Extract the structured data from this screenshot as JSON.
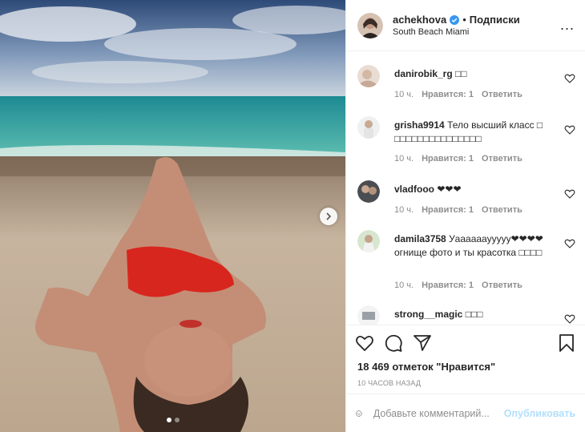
{
  "header": {
    "username": "achekhova",
    "separator": "•",
    "follow_label": "Подписки",
    "location": "South Beach Miami",
    "more_label": "..."
  },
  "comments": [
    {
      "user": "danirobik_rg",
      "text": "□□",
      "time": "10 ч.",
      "likes": "Нравится: 1",
      "reply": "Ответить"
    },
    {
      "user": "grisha9914",
      "text": "Тело высший класс □ □□□□□□□□□□□□□□□",
      "time": "10 ч.",
      "likes": "Нравится: 1",
      "reply": "Ответить"
    },
    {
      "user": "vladfooo",
      "text": "❤❤❤",
      "time": "10 ч.",
      "likes": "Нравится: 1",
      "reply": "Ответить"
    },
    {
      "user": "damila3758",
      "text": "Уаааааауyyyy❤❤❤❤ огнище фото и ты красотка □□□□",
      "time": "10 ч.",
      "likes": "Нравится: 1",
      "reply": "Ответить"
    },
    {
      "user": "strong__magic",
      "text": "□□□"
    }
  ],
  "likes_text": "18 469 отметок \"Нравится\"",
  "timestamp": "10 часов назад",
  "add_comment": {
    "placeholder": "Добавьте комментарий...",
    "publish_label": "Опубликовать"
  },
  "carousel": {
    "current": 1,
    "total": 2
  },
  "colors": {
    "verified": "#3897f0",
    "publish": "#b2dffc",
    "meta": "#8e8e8e",
    "text": "#262626"
  },
  "icons": [
    "like-icon",
    "comment-icon",
    "share-icon",
    "save-icon",
    "emoji-icon",
    "heart-small-icon",
    "chevron-right-icon",
    "verified-badge-icon"
  ]
}
